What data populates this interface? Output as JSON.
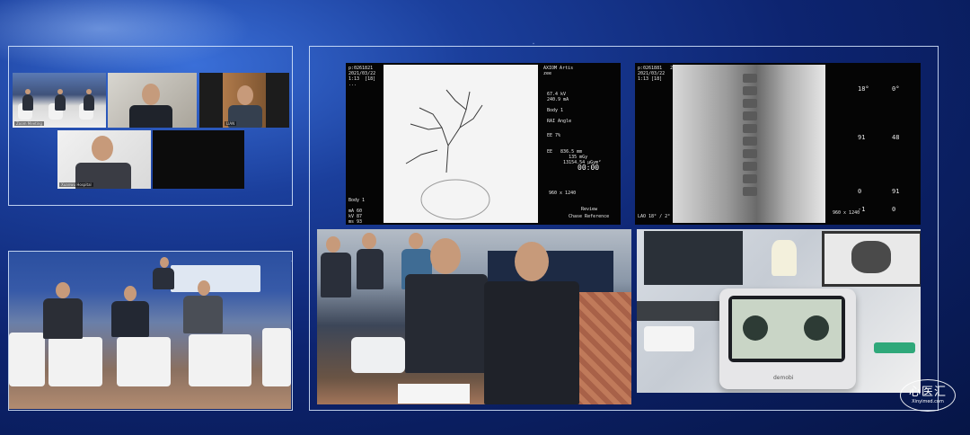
{
  "colors": {
    "frame": "#dce8ff",
    "background": "#0d2470"
  },
  "zoom_grid": {
    "tiles": [
      {
        "label": "Zoom Meeting"
      },
      {
        "label": ""
      },
      {
        "label": "LIAN"
      },
      {
        "label": "Xuanwu Hospital"
      },
      {
        "label": ""
      }
    ]
  },
  "xray_left": {
    "top_left": "p:0261821  \n2021/03/22\n1:13  [18]\n...",
    "top_right": "AXIOM Artis\nzee  \n",
    "params": "67.4 kV\n240.9 mA\n\nBody 1\n\nRAI Angle",
    "bottom_left": "Body 1\n\nmA 60\nkV 87\nms 93\nLAO 18° / 5°",
    "mid_right": "EE 7%\n\n\nEE   836.5 mm\n        135 mGy\n      13154.54 µGym²",
    "timer": "00:00",
    "size": "960 x 1240",
    "review": "Review",
    "chase": "Chase Reference"
  },
  "xray_right": {
    "top_left": "p:0261881   22\n2021/03/22\n1:13 [18]",
    "readouts": [
      "18°",
      "0°",
      "91",
      "48",
      "0",
      "91",
      "-1",
      "0"
    ],
    "size": "960 x 1240",
    "bottom_left": "LAO 18° / 2°"
  },
  "device": {
    "brand": "demobi"
  },
  "logo": {
    "main": "心医汇",
    "sub": "Xinyimed.com"
  }
}
